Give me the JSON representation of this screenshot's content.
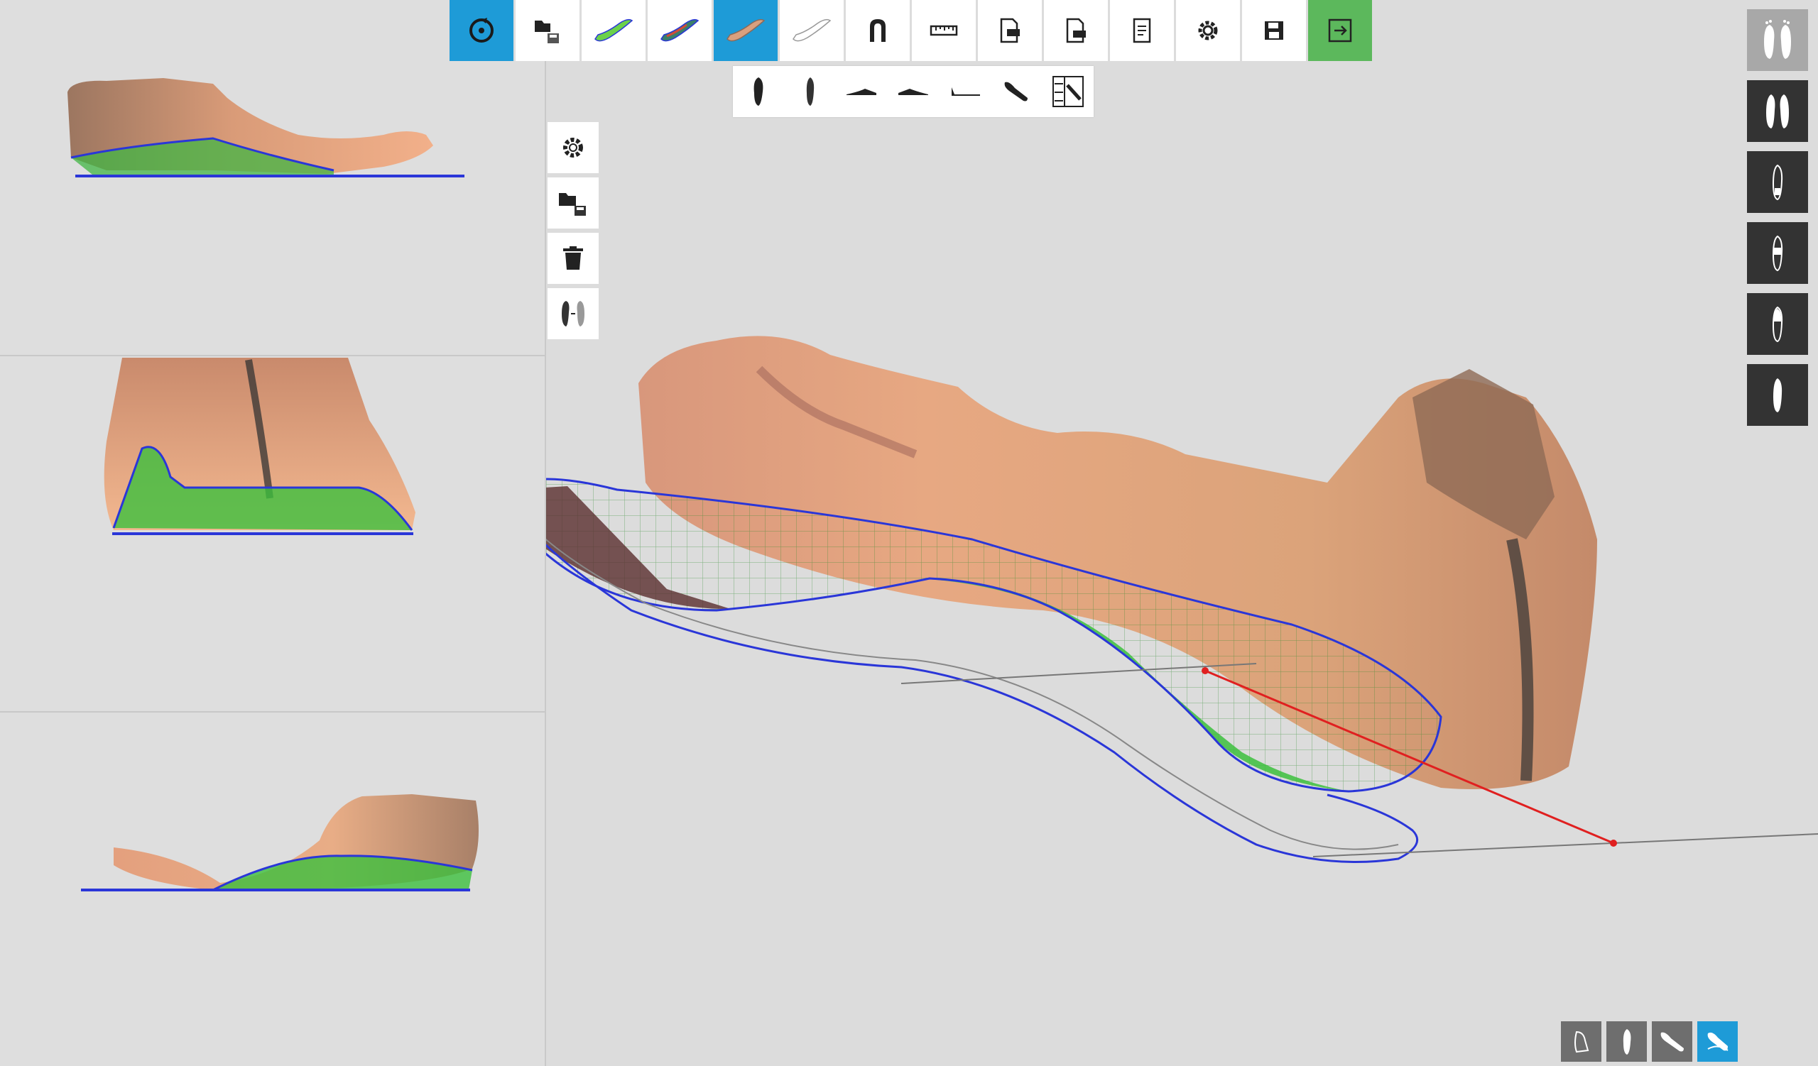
{
  "toolbar": {
    "buttons": [
      {
        "name": "reset-view-icon",
        "active": true
      },
      {
        "name": "open-files-icon"
      },
      {
        "name": "insole-green-icon"
      },
      {
        "name": "insole-color-icon"
      },
      {
        "name": "insole-foot-icon",
        "active": true
      },
      {
        "name": "insole-outline-icon"
      },
      {
        "name": "heel-cup-icon"
      },
      {
        "name": "ruler-icon"
      },
      {
        "name": "export-jpg-icon"
      },
      {
        "name": "export-pdf-icon"
      },
      {
        "name": "report-icon"
      },
      {
        "name": "settings-icon"
      },
      {
        "name": "save-icon"
      },
      {
        "name": "exit-icon",
        "accent": "#5cb85c"
      }
    ]
  },
  "view_toolbar": {
    "buttons": [
      "foot-top-icon",
      "foot-bottom-icon",
      "side-lateral-icon",
      "side-medial-icon",
      "side-profile-icon",
      "foot-angle-icon",
      "split-view-icon"
    ]
  },
  "side_tools": {
    "buttons": [
      "gear-icon",
      "folder-save-icon",
      "trash-icon",
      "mirror-feet-icon"
    ]
  },
  "right_bar": {
    "buttons": [
      "both-feet-icon",
      "pair-feet-icon",
      "left-foot-icon",
      "foot-marker-icon",
      "right-foot-icon",
      "single-foot-icon"
    ]
  },
  "bottom_bar": {
    "buttons": [
      "foot-side-view-icon",
      "foot-top-view-icon",
      "foot-angled-view-icon",
      "foot-3d-view-icon"
    ],
    "active_index": 3
  },
  "colors": {
    "accent_blue": "#1e9bd7",
    "accent_green": "#5cb85c",
    "insole_outline": "#2a36d8",
    "mesh_green": "#39c43a",
    "skin": "#e8a67e",
    "measure_line": "#e02020"
  }
}
